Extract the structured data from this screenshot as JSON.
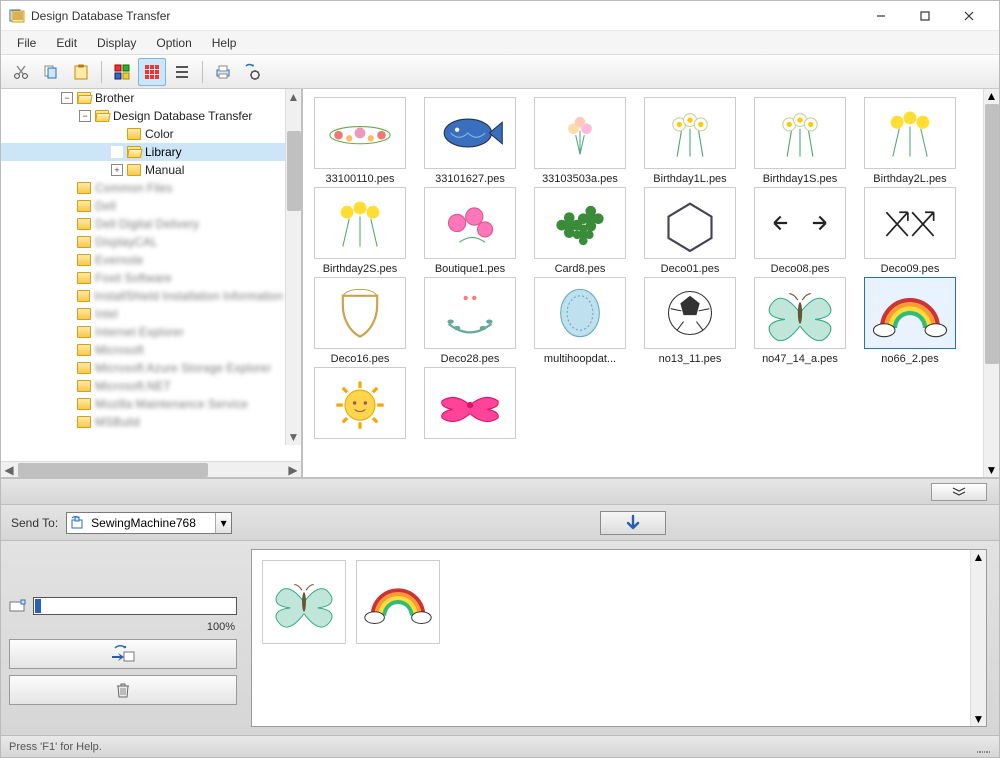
{
  "window": {
    "title": "Design Database Transfer"
  },
  "menu": {
    "file": "File",
    "edit": "Edit",
    "display": "Display",
    "option": "Option",
    "help": "Help"
  },
  "tree": {
    "root": "Brother",
    "app": "Design Database Transfer",
    "children": {
      "color": "Color",
      "library": "Library",
      "manual": "Manual"
    },
    "blurred": [
      "Common Files",
      "Dell",
      "Dell Digital Delivery",
      "DisplayCAL",
      "Evernote",
      "Foxit Software",
      "InstallShield Installation Information",
      "Intel",
      "Internet Explorer",
      "Microsoft",
      "Microsoft Azure Storage Explorer",
      "Microsoft.NET",
      "Mozilla Maintenance Service",
      "MSBuild"
    ]
  },
  "thumbs": [
    {
      "label": "33100110.pes",
      "kind": "flowers-garland"
    },
    {
      "label": "33101627.pes",
      "kind": "fish"
    },
    {
      "label": "33103503a.pes",
      "kind": "bouquet"
    },
    {
      "label": "Birthday1L.pes",
      "kind": "daffodils"
    },
    {
      "label": "Birthday1S.pes",
      "kind": "daffodils"
    },
    {
      "label": "Birthday2L.pes",
      "kind": "yellow-flowers"
    },
    {
      "label": "Birthday2S.pes",
      "kind": "yellow-flowers"
    },
    {
      "label": "Boutique1.pes",
      "kind": "pink-flowers"
    },
    {
      "label": "Card8.pes",
      "kind": "clovers"
    },
    {
      "label": "Deco01.pes",
      "kind": "hexagon"
    },
    {
      "label": "Deco08.pes",
      "kind": "arrows"
    },
    {
      "label": "Deco09.pes",
      "kind": "crossed-arrows"
    },
    {
      "label": "Deco16.pes",
      "kind": "shield-frame"
    },
    {
      "label": "Deco28.pes",
      "kind": "laurel"
    },
    {
      "label": "multihoopdat...",
      "kind": "oval-lace"
    },
    {
      "label": "no13_11.pes",
      "kind": "soccer-ball"
    },
    {
      "label": "no47_14_a.pes",
      "kind": "butterfly"
    },
    {
      "label": "no66_2.pes",
      "kind": "rainbow",
      "selected": true
    },
    {
      "label": "",
      "kind": "sun"
    },
    {
      "label": "",
      "kind": "bow-ribbon"
    }
  ],
  "sendto": {
    "label": "Send To:",
    "value": "SewingMachine768"
  },
  "queue": [
    {
      "kind": "butterfly"
    },
    {
      "kind": "rainbow"
    }
  ],
  "progress": {
    "percent_label": "100%",
    "percent": 100
  },
  "status": {
    "text": "Press 'F1' for Help."
  }
}
